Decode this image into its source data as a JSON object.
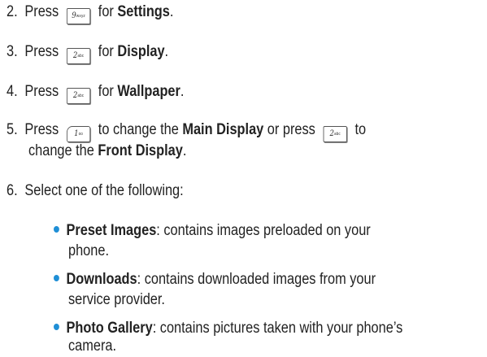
{
  "steps": [
    {
      "number": "2.",
      "pre": "Press",
      "key": {
        "digit": "9",
        "letters": "wxyz",
        "style": "rect"
      },
      "mid": "for",
      "bold": "Settings",
      "post": "."
    },
    {
      "number": "3.",
      "pre": "Press",
      "key": {
        "digit": "2",
        "letters": "abc",
        "style": "rect"
      },
      "mid": "for",
      "bold": "Display",
      "post": "."
    },
    {
      "number": "4.",
      "pre": "Press",
      "key": {
        "digit": "2",
        "letters": "abc",
        "style": "rect"
      },
      "mid": "for",
      "bold": "Wallpaper",
      "post": "."
    },
    {
      "number": "5.",
      "pre": "Press",
      "key1": {
        "digit": "1",
        "letters": "oo",
        "style": "round"
      },
      "mid1": "to change the",
      "bold1": "Main Display",
      "mid2": "or press",
      "key2": {
        "digit": "2",
        "letters": "abc",
        "style": "rect"
      },
      "mid3": "to",
      "line2_pre": "change the",
      "line2_bold": "Front Display",
      "line2_post": "."
    },
    {
      "number": "6.",
      "text": "Select one of the following:"
    }
  ],
  "options": [
    {
      "bold": "Preset Images",
      "text": ": contains images preloaded on your",
      "cont": "phone."
    },
    {
      "bold": "Downloads",
      "text": ": contains downloaded images from your",
      "cont": "service provider."
    },
    {
      "bold": "Photo Gallery",
      "text": ": contains pictures taken with your phone’s",
      "cont": "camera."
    }
  ],
  "colors": {
    "text": "#222222",
    "bullet": "#1f8fd6"
  }
}
